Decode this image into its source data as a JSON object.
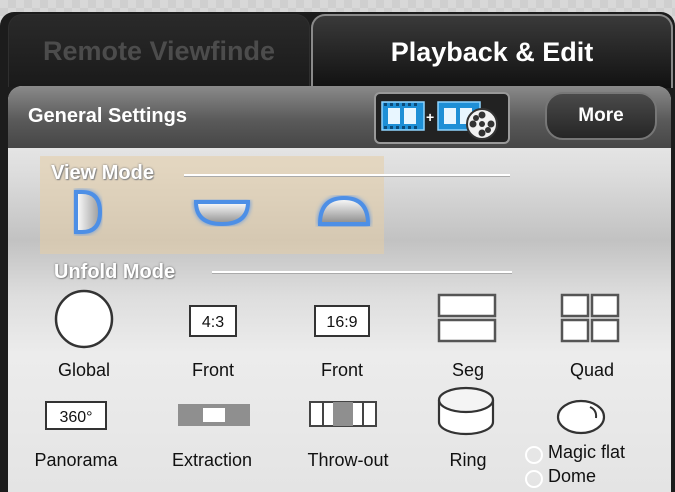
{
  "tabs": {
    "remote": "Remote Viewfinde",
    "playback": "Playback & Edit"
  },
  "header": {
    "title": "General Settings",
    "more": "More",
    "video_icon": "video-merge-icon"
  },
  "view_mode": {
    "title": "View Mode",
    "icons": [
      "half-dome-side-icon",
      "half-dome-front-icon",
      "dome-top-icon"
    ]
  },
  "unfold_mode": {
    "title": "Unfold Mode",
    "row1": [
      {
        "label": "Global",
        "icon": "circle-icon"
      },
      {
        "label": "Front",
        "icon": "ratio-4-3-icon",
        "ratio": "4:3"
      },
      {
        "label": "Front",
        "icon": "ratio-16-9-icon",
        "ratio": "16:9"
      },
      {
        "label": "Seg",
        "icon": "split-two-icon"
      },
      {
        "label": "Quad",
        "icon": "split-four-icon"
      }
    ],
    "row2": [
      {
        "label": "Panorama",
        "icon": "panorama-360-icon",
        "text": "360°"
      },
      {
        "label": "Extraction",
        "icon": "extraction-icon"
      },
      {
        "label": "Throw-out",
        "icon": "throw-out-icon"
      },
      {
        "label": "Ring",
        "icon": "ring-icon"
      }
    ],
    "dome_options": {
      "icon": "dome-ball-icon",
      "options": [
        "Magic flat",
        "Dome"
      ]
    }
  },
  "colors": {
    "accent_glow": "#4d8fe6",
    "panel_top": "#c4c4c4",
    "highlight": "#e6cda5"
  }
}
